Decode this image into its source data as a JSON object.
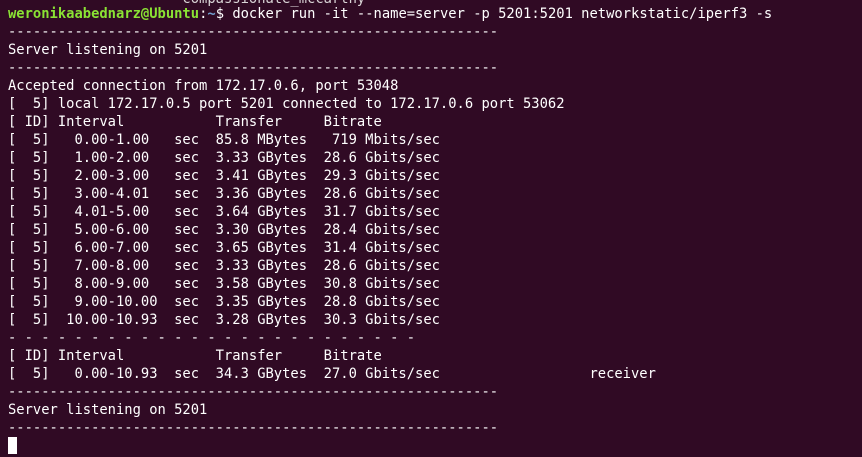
{
  "cut_off_text": "                     compassionate_mccarthy",
  "prompt": {
    "user_host": "weronikaabednarz@Ubuntu",
    "separator": ":",
    "path": "~",
    "symbol": "$ ",
    "command": "docker run -it --name=server -p 5201:5201 networkstatic/iperf3 -s"
  },
  "output": {
    "dash_line": "-----------------------------------------------------------",
    "dash_dotted": "- - - - - - - - - - - - - - - - - - - - - - - - -",
    "listening": "Server listening on 5201",
    "accepted": "Accepted connection from 172.17.0.6, port 53048",
    "local": "[  5] local 172.17.0.5 port 5201 connected to 172.17.0.6 port 53062",
    "header": "[ ID] Interval           Transfer     Bitrate",
    "intervals": [
      "[  5]   0.00-1.00   sec  85.8 MBytes   719 Mbits/sec",
      "[  5]   1.00-2.00   sec  3.33 GBytes  28.6 Gbits/sec",
      "[  5]   2.00-3.00   sec  3.41 GBytes  29.3 Gbits/sec",
      "[  5]   3.00-4.01   sec  3.36 GBytes  28.6 Gbits/sec",
      "[  5]   4.01-5.00   sec  3.64 GBytes  31.7 Gbits/sec",
      "[  5]   5.00-6.00   sec  3.30 GBytes  28.4 Gbits/sec",
      "[  5]   6.00-7.00   sec  3.65 GBytes  31.4 Gbits/sec",
      "[  5]   7.00-8.00   sec  3.33 GBytes  28.6 Gbits/sec",
      "[  5]   8.00-9.00   sec  3.58 GBytes  30.8 Gbits/sec",
      "[  5]   9.00-10.00  sec  3.35 GBytes  28.8 Gbits/sec",
      "[  5]  10.00-10.93  sec  3.28 GBytes  30.3 Gbits/sec"
    ],
    "summary_header": "[ ID] Interval           Transfer     Bitrate",
    "summary": "[  5]   0.00-10.93  sec  34.3 GBytes  27.0 Gbits/sec                  receiver",
    "listening_again": "Server listening on 5201"
  },
  "colors": {
    "background": "#300a24",
    "user_host": "#8ae234",
    "path": "#729fcf",
    "text": "#ffffff"
  }
}
